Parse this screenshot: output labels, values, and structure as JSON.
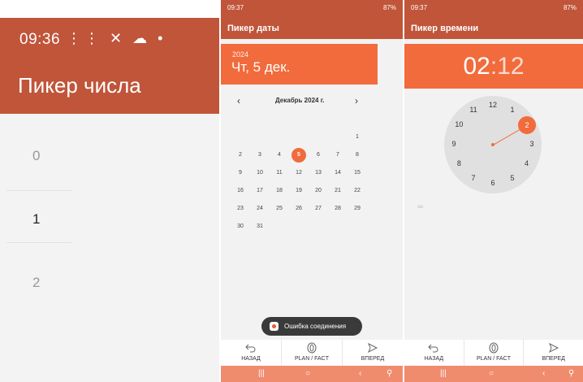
{
  "number_picker": {
    "status_time": "09:36",
    "status_icons": "⋮⋮ ✕ ☁ •",
    "title": "Пикер числа",
    "values": [
      "0",
      "1",
      "2"
    ],
    "selected": "1"
  },
  "date_picker": {
    "status_time": "09:37",
    "status_right": "87%",
    "title": "Пикер даты",
    "year": "2024",
    "date_text": "Чт, 5 дек.",
    "month_label": "Декабрь 2024 г.",
    "prev_icon": "chevron-left-icon",
    "next_icon": "chevron-right-icon",
    "days": [
      "1",
      "2",
      "3",
      "4",
      "5",
      "6",
      "7",
      "8",
      "9",
      "10",
      "11",
      "12",
      "13",
      "14",
      "15",
      "16",
      "17",
      "18",
      "19",
      "20",
      "21",
      "22",
      "23",
      "24",
      "25",
      "26",
      "27",
      "28",
      "29",
      "30",
      "31"
    ],
    "selected_day": "5",
    "toast": "Ошибка соединения"
  },
  "time_picker": {
    "status_time": "09:37",
    "status_right": "87%",
    "title": "Пикер времени",
    "hours": "02",
    "minutes": "12",
    "clock_numbers": [
      "12",
      "1",
      "2",
      "3",
      "4",
      "5",
      "6",
      "7",
      "8",
      "9",
      "10",
      "11"
    ],
    "selected_hour": "2"
  },
  "bottom_bar": {
    "back_label": "НАЗАД",
    "plan_label": "PLAN / FACT",
    "forward_label": "ВПЕРЕД"
  },
  "colors": {
    "header": "#c0553a",
    "accent": "#f26b3c",
    "navbar": "#f08c6e"
  }
}
